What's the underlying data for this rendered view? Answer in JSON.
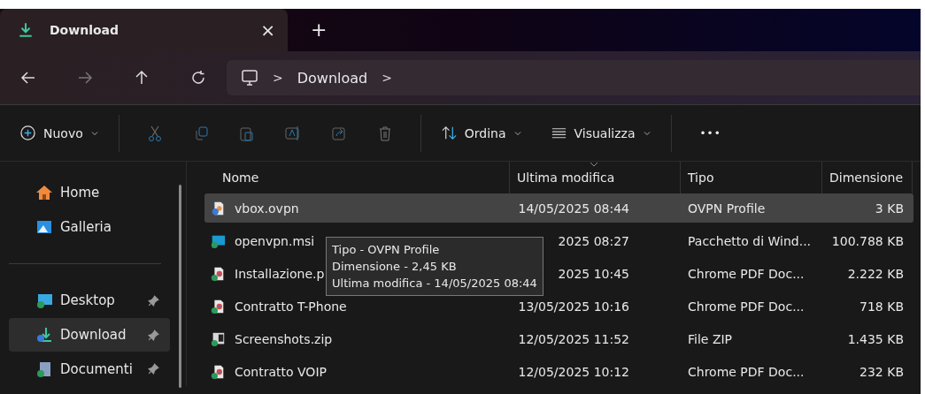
{
  "tab": {
    "title": "Download",
    "close": "×",
    "new": "+"
  },
  "breadcrumb": {
    "separator_1": ">",
    "folder": "Download",
    "separator_2": ">"
  },
  "commands": {
    "new": "Nuovo",
    "sort": "Ordina",
    "view": "Visualizza",
    "more": "•••"
  },
  "sidebar": {
    "items": [
      {
        "label": "Home",
        "kind": "home",
        "pinned": false,
        "selected": false
      },
      {
        "label": "Galleria",
        "kind": "gallery",
        "pinned": false,
        "selected": false
      },
      {
        "label": "Desktop",
        "kind": "desktop",
        "pinned": true,
        "selected": false
      },
      {
        "label": "Download",
        "kind": "download",
        "pinned": true,
        "selected": true
      },
      {
        "label": "Documenti",
        "kind": "documents",
        "pinned": true,
        "selected": false
      }
    ]
  },
  "table": {
    "columns": [
      "Nome",
      "Ultima modifica",
      "Tipo",
      "Dimensione"
    ],
    "rows": [
      {
        "name": "vbox.ovpn",
        "kind": "ovpn",
        "modified": "14/05/2025 08:44",
        "type": "OVPN Profile",
        "size": "3 KB",
        "selected": true
      },
      {
        "name": "openvpn.msi",
        "kind": "msi",
        "modified": "2025 08:27",
        "type": "Pacchetto di Wind...",
        "size": "100.788 KB",
        "selected": false
      },
      {
        "name": "Installazione.p",
        "kind": "pdf",
        "modified": "2025 10:45",
        "type": "Chrome PDF Doc...",
        "size": "2.222 KB",
        "selected": false
      },
      {
        "name": "Contratto T-Phone",
        "kind": "pdf",
        "modified": "13/05/2025 10:16",
        "type": "Chrome PDF Doc...",
        "size": "718 KB",
        "selected": false
      },
      {
        "name": "Screenshots.zip",
        "kind": "zip",
        "modified": "12/05/2025 11:52",
        "type": "File ZIP",
        "size": "1.435 KB",
        "selected": false
      },
      {
        "name": "Contratto VOIP",
        "kind": "pdf",
        "modified": "12/05/2025 10:12",
        "type": "Chrome PDF Doc...",
        "size": "232 KB",
        "selected": false
      }
    ]
  },
  "tooltip": {
    "lines": [
      "Tipo - OVPN Profile",
      "Dimensione - 2,45 KB",
      "Ultima modifica - 14/05/2025 08:44"
    ]
  }
}
